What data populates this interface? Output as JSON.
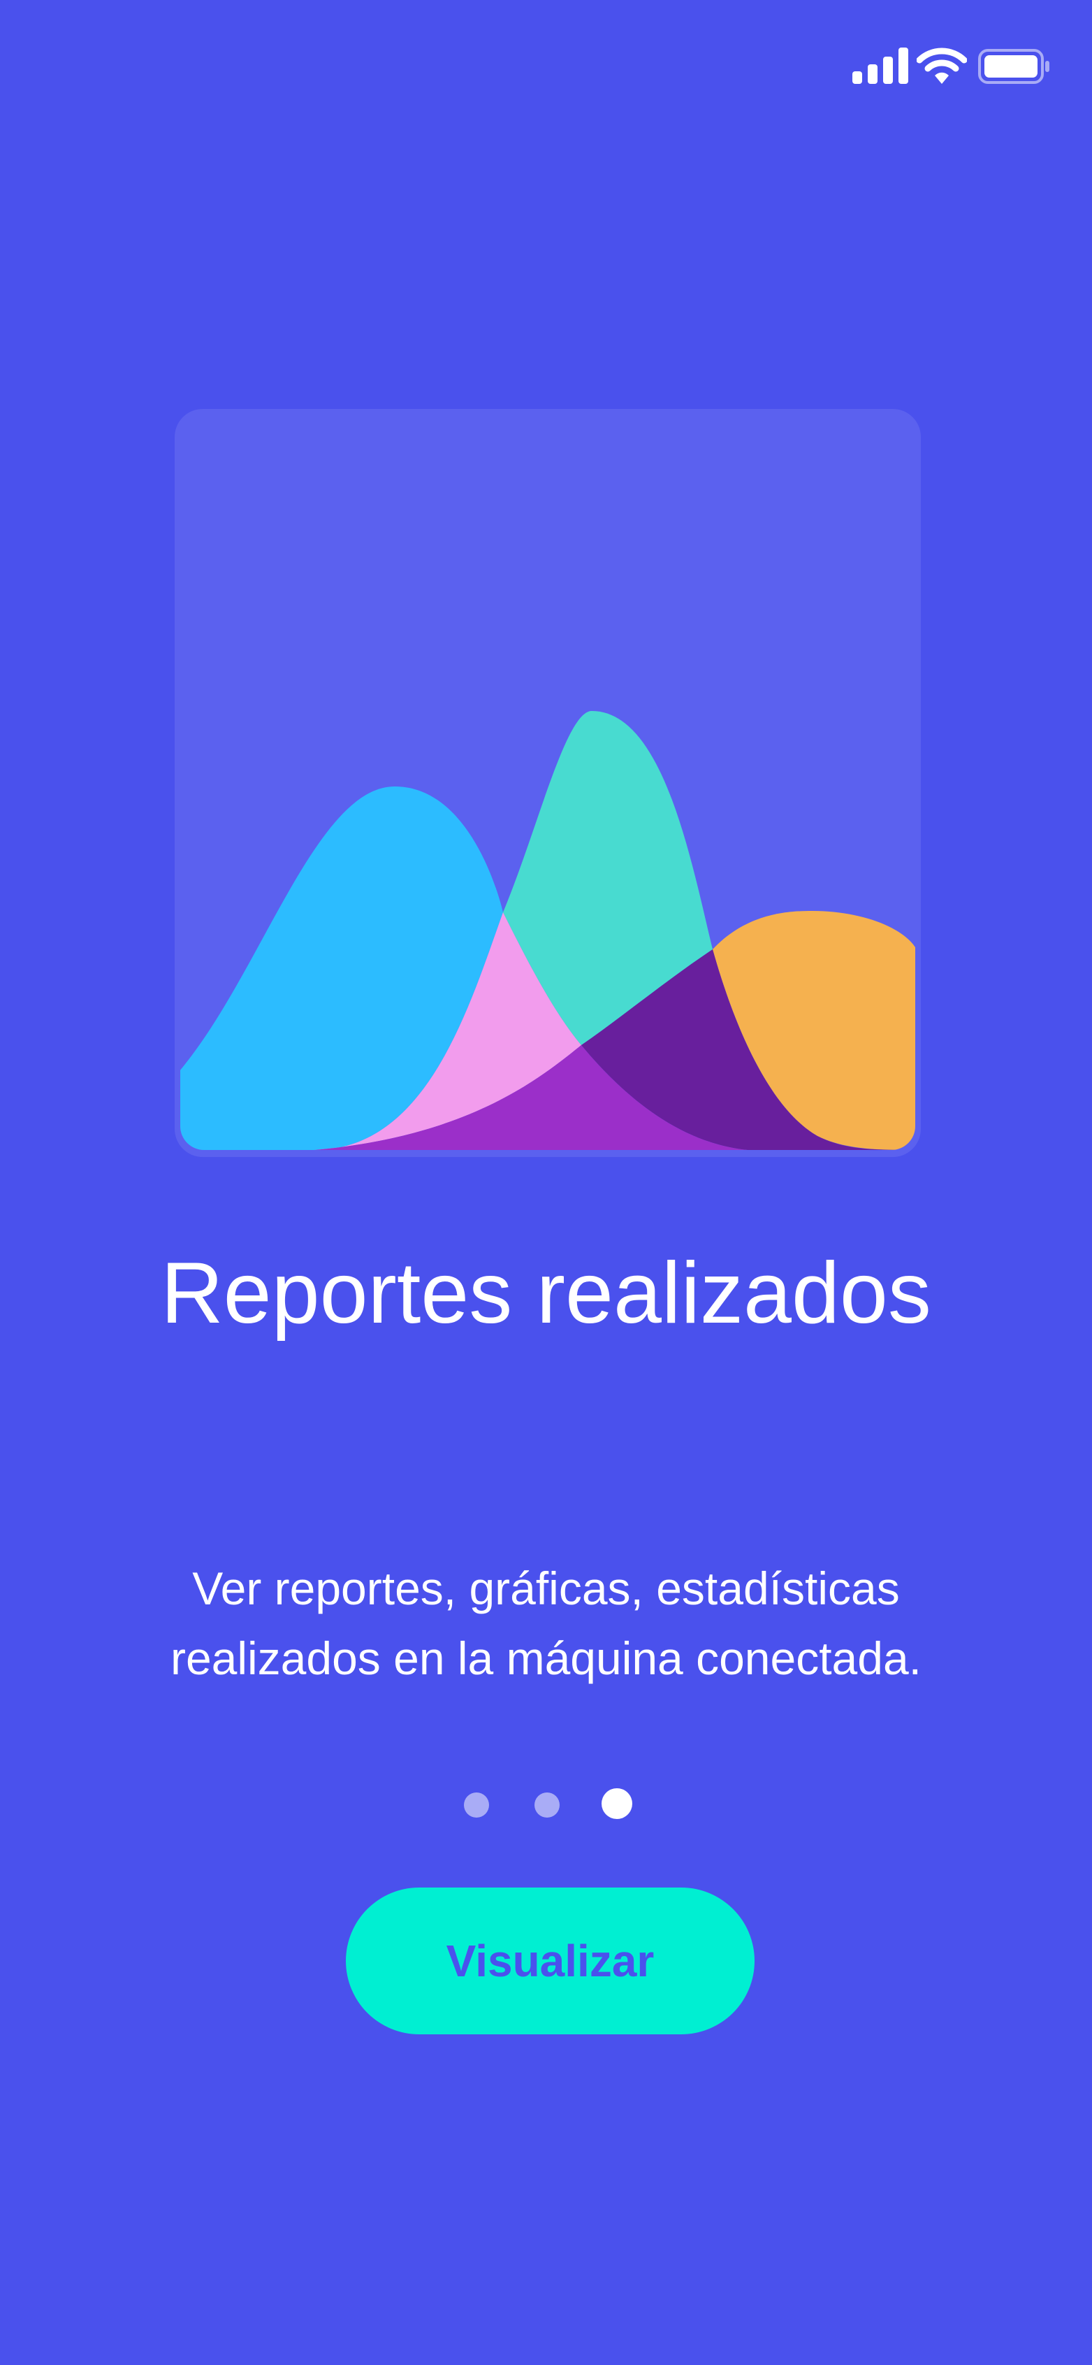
{
  "status_bar": {
    "signal_icon": "cellular-signal-icon",
    "wifi_icon": "wifi-icon",
    "battery_icon": "battery-full-icon"
  },
  "illustration": {
    "icon": "area-chart-illustration",
    "colors": {
      "card": "#5b61ef",
      "blue": "#2cbcff",
      "teal": "#48dbd0",
      "pink": "#f29ced",
      "purple": "#9b2fc9",
      "dark_purple": "#681f9d",
      "orange": "#f5b14f"
    }
  },
  "onboarding": {
    "title": "Reportes realizados",
    "description_line_1": "Ver reportes, gráficas, estadísticas",
    "description_line_2": "realizados en la máquina conectada.",
    "current_page": 3,
    "total_pages": 3,
    "button_label": "Visualizar"
  },
  "colors": {
    "background": "#4a51ed",
    "accent": "#00efd2",
    "dot_inactive": "#a9acf6",
    "dot_active": "#ffffff",
    "text": "#ffffff"
  }
}
